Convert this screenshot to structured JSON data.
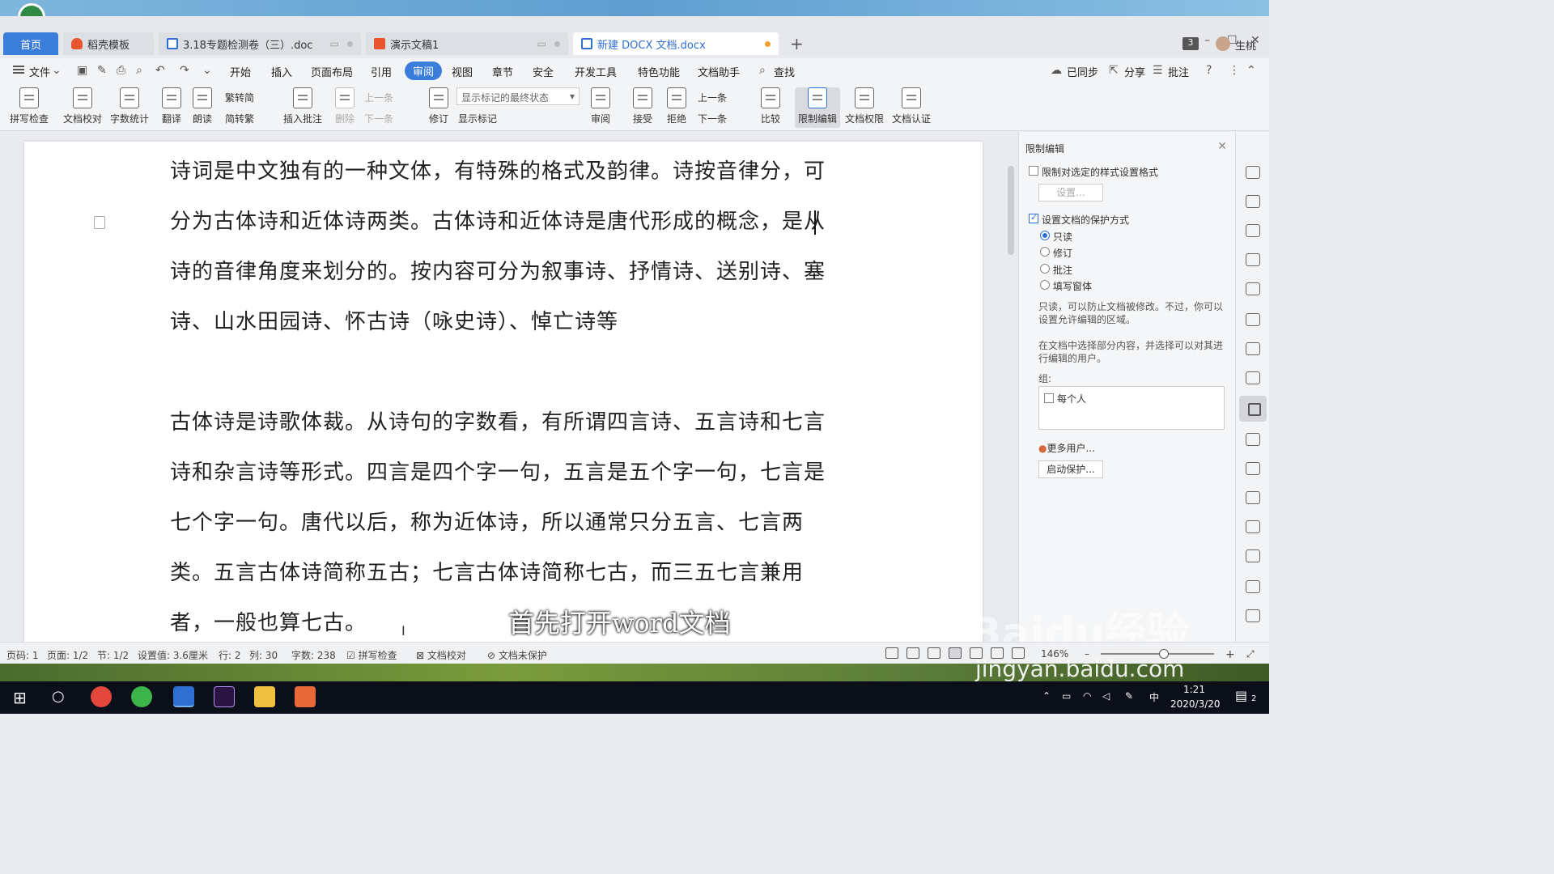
{
  "tabs": [
    {
      "label": "首页"
    },
    {
      "label": "稻壳模板"
    },
    {
      "label": "3.18专题检测卷（三）.doc"
    },
    {
      "label": "演示文稿1"
    },
    {
      "label": "新建 DOCX 文档.docx"
    }
  ],
  "window": {
    "badge": "3",
    "user": "生桃"
  },
  "menu": {
    "file": "文件",
    "items": [
      "开始",
      "插入",
      "页面布局",
      "引用",
      "审阅",
      "视图",
      "章节",
      "安全",
      "开发工具",
      "特色功能",
      "文档助手"
    ],
    "active": "审阅",
    "search": "查找",
    "right": [
      "已同步",
      "分享",
      "批注"
    ]
  },
  "ribbon": {
    "spell": "拼写检查",
    "proof": "文档校对",
    "wordcount": "字数统计",
    "translate": "翻译",
    "read": "朗读",
    "trad": "繁转简",
    "simp": "简转繁",
    "insert_comment": "插入批注",
    "delete": "删除",
    "prev": "上一条",
    "next": "下一条",
    "track": "修订",
    "markup_state": "显示标记的最终状态",
    "show_markup": "显示标记",
    "review": "审阅",
    "accept": "接受",
    "reject": "拒绝",
    "prev2": "上一条",
    "next2": "下一条",
    "compare": "比较",
    "restrict": "限制编辑",
    "rights": "文档权限",
    "cert": "文档认证"
  },
  "document": {
    "p1": "诗词是中文独有的一种文体，有特殊的格式及韵律。诗按音律分，可分为古体诗和近体诗两类。古体诗和近体诗是唐代形成的概念，是从诗的音律角度来划分的。按内容可分为叙事诗、抒情诗、送别诗、塞诗、山水田园诗、怀古诗（咏史诗）、悼亡诗等",
    "p2": "古体诗是诗歌体裁。从诗句的字数看，有所谓四言诗、五言诗和七言诗和杂言诗等形式。四言是四个字一句，五言是五个字一句，七言是七个字一句。唐代以后，称为近体诗，所以通常只分五言、七言两类。五言古体诗简称五古；七言古体诗简称七古，而三五七言兼用者，一般也算七古。",
    "caption": "首先打开word文档"
  },
  "panel": {
    "title": "限制编辑",
    "limit_style": "限制对选定的样式设置格式",
    "settings_btn": "设置...",
    "protect_mode": "设置文档的保护方式",
    "options": [
      "只读",
      "修订",
      "批注",
      "填写窗体"
    ],
    "selected": "只读",
    "desc1": "只读，可以防止文档被修改。不过，你可以设置允许编辑的区域。",
    "desc2": "在文档中选择部分内容，并选择可以对其进行编辑的用户。",
    "group_label": "组:",
    "everyone": "每个人",
    "more_users": "更多用户...",
    "start_btn": "启动保护..."
  },
  "status": {
    "page": "页码: 1",
    "pages": "页面: 1/2",
    "section": "节: 1/2",
    "setting": "设置值: 3.6厘米",
    "row": "行: 2",
    "col": "列: 30",
    "chars": "字数: 238",
    "spell": "拼写检查",
    "proof": "文档校对",
    "unprotected": "文档未保护",
    "zoom": "146%"
  },
  "taskbar": {
    "time": "1:21",
    "date": "2020/3/20",
    "ime": "中",
    "notif": "2"
  },
  "watermark": {
    "site": "jingyan.baidu.com",
    "brand": "Baidu经验"
  }
}
